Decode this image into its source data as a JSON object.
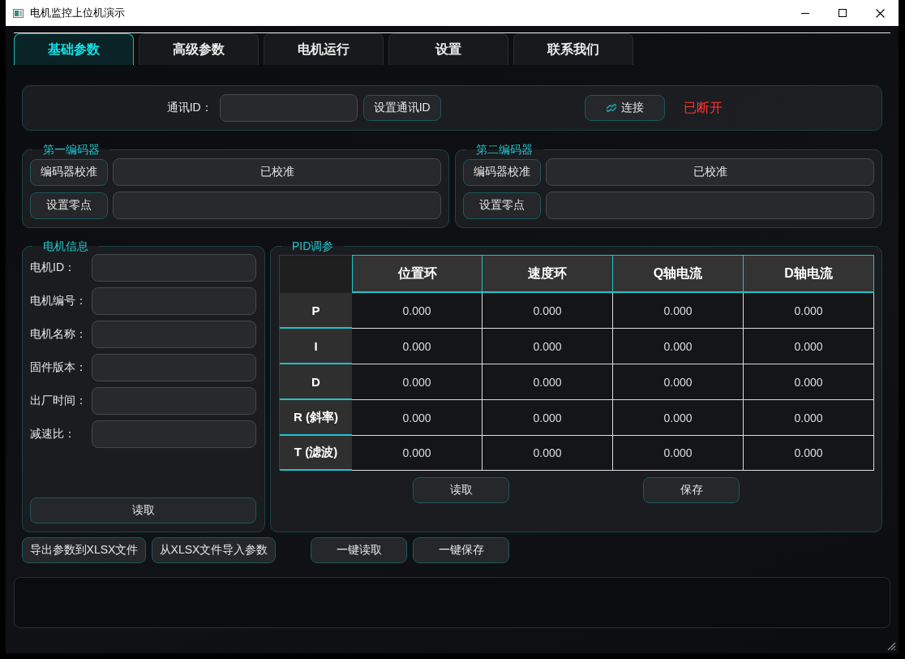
{
  "window": {
    "title": "电机监控上位机演示"
  },
  "tabs": [
    {
      "label": "基础参数",
      "selected": true
    },
    {
      "label": "高级参数",
      "selected": false
    },
    {
      "label": "电机运行",
      "selected": false
    },
    {
      "label": "设置",
      "selected": false
    },
    {
      "label": "联系我们",
      "selected": false
    }
  ],
  "connection": {
    "id_label": "通讯ID：",
    "set_id_button": "设置通讯ID",
    "connect_button": "连接",
    "status": "已断开",
    "connected": false
  },
  "encoders": [
    {
      "title": "第一编码器",
      "calibrate_button": "编码器校准",
      "calibration_status": "已校准",
      "zero_button": "设置零点"
    },
    {
      "title": "第二编码器",
      "calibrate_button": "编码器校准",
      "calibration_status": "已校准",
      "zero_button": "设置零点"
    }
  ],
  "motor_info": {
    "title": "电机信息",
    "fields": [
      {
        "label": "电机ID："
      },
      {
        "label": "电机编号："
      },
      {
        "label": "电机名称："
      },
      {
        "label": "固件版本："
      },
      {
        "label": "出厂时间："
      },
      {
        "label": "减速比："
      }
    ],
    "read_button": "读取"
  },
  "pid": {
    "title": "PID调参",
    "columns": [
      "位置环",
      "速度环",
      "Q轴电流",
      "D轴电流"
    ],
    "rows": [
      {
        "label": "P",
        "values": [
          "0.000",
          "0.000",
          "0.000",
          "0.000"
        ]
      },
      {
        "label": "I",
        "values": [
          "0.000",
          "0.000",
          "0.000",
          "0.000"
        ]
      },
      {
        "label": "D",
        "values": [
          "0.000",
          "0.000",
          "0.000",
          "0.000"
        ]
      },
      {
        "label": "R (斜率)",
        "values": [
          "0.000",
          "0.000",
          "0.000",
          "0.000"
        ]
      },
      {
        "label": "T (滤波)",
        "values": [
          "0.000",
          "0.000",
          "0.000",
          "0.000"
        ]
      }
    ],
    "read_button": "读取",
    "save_button": "保存"
  },
  "file_buttons": [
    "导出参数到XLSX文件",
    "从XLSX文件导入参数"
  ],
  "bulk_buttons": [
    "一键读取",
    "一键保存"
  ]
}
